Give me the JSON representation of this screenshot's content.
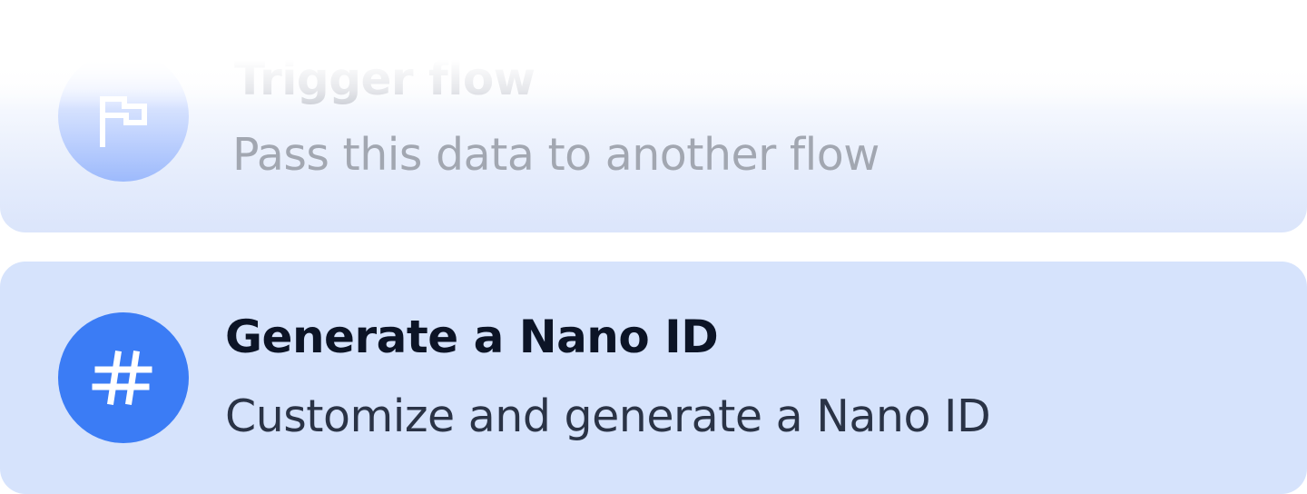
{
  "items": [
    {
      "title": "Trigger flow",
      "description": "Pass this data to another flow",
      "icon": "flag-icon",
      "state": "faded"
    },
    {
      "title": "Generate a Nano ID",
      "description": "Customize and generate a Nano ID",
      "icon": "hash-icon",
      "state": "highlighted"
    }
  ],
  "colors": {
    "highlight_background": "#d6e3fc",
    "icon_background": "#3b7cf5",
    "title_text": "#0c1426",
    "description_text": "#2a3346"
  }
}
